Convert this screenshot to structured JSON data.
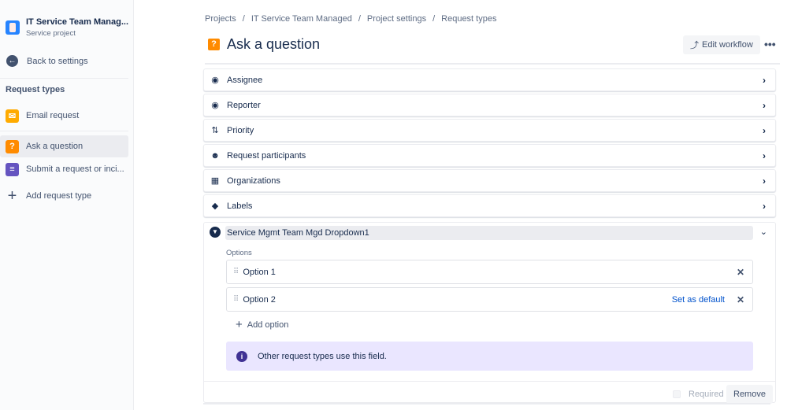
{
  "sidebar": {
    "project": {
      "name": "IT Service Team Manag...",
      "type": "Service project"
    },
    "back_label": "Back to settings",
    "section_title": "Request types",
    "items": [
      {
        "label": "Email request",
        "icon": "envelope-icon",
        "color": "#FFAB00",
        "active": false
      },
      {
        "label": "Ask a question",
        "icon": "question-icon",
        "color": "#FF8B00",
        "active": true
      },
      {
        "label": "Submit a request or inci...",
        "icon": "document-icon",
        "color": "#6554C0",
        "active": false
      }
    ],
    "add_label": "Add request type"
  },
  "breadcrumbs": [
    "Projects",
    "IT Service Team Managed",
    "Project settings",
    "Request types"
  ],
  "header": {
    "title": "Ask a question",
    "edit_workflow_label": "Edit workflow",
    "more_label": "•••"
  },
  "fields": [
    {
      "label": "Assignee",
      "icon": "user-circle-icon"
    },
    {
      "label": "Reporter",
      "icon": "user-circle-icon"
    },
    {
      "label": "Priority",
      "icon": "priority-arrows-icon"
    },
    {
      "label": "Request participants",
      "icon": "people-icon"
    },
    {
      "label": "Organizations",
      "icon": "building-icon"
    },
    {
      "label": "Labels",
      "icon": "tag-icon"
    }
  ],
  "expanded_field": {
    "name": "Service Mgmt Team Mgd Dropdown1",
    "options_label": "Options",
    "options": [
      {
        "label": "Option 1",
        "set_default": ""
      },
      {
        "label": "Option 2",
        "set_default": "Set as default"
      }
    ],
    "add_option_label": "Add option",
    "info_message": "Other request types use this field.",
    "required_label": "Required",
    "required_checked": false,
    "remove_label": "Remove"
  },
  "colors": {
    "accent": "#0052CC",
    "info_bg": "#EAE6FF",
    "info_icon": "#403294"
  }
}
